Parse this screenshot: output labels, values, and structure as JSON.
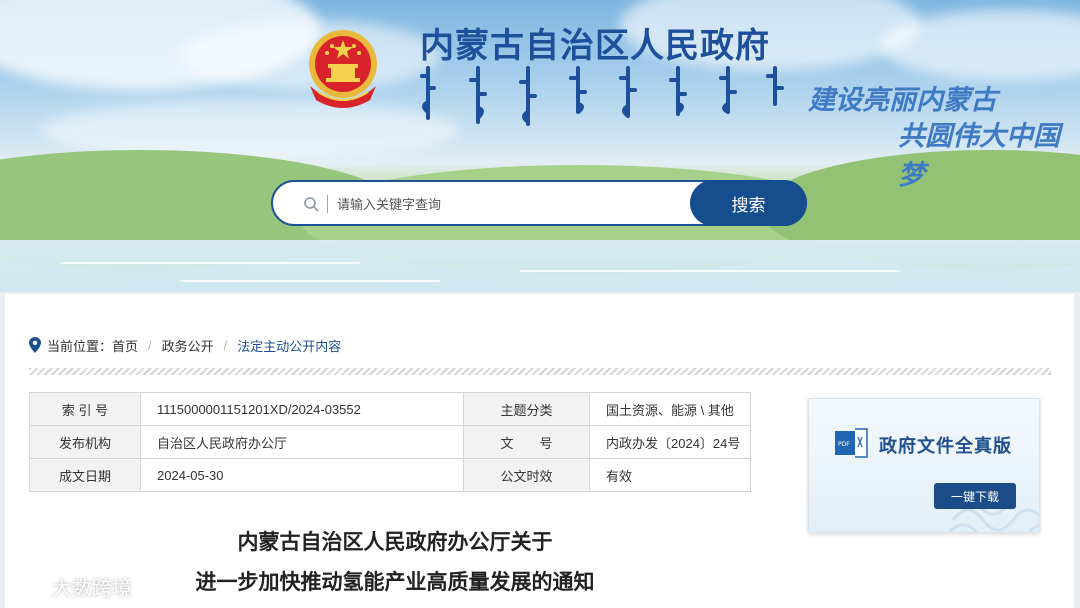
{
  "header": {
    "site_title": "内蒙古自治区人民政府",
    "slogan_line1": "建设亮丽内蒙古",
    "slogan_line2": "共圆伟大中国梦",
    "emblem_icon": "national-emblem-icon"
  },
  "search": {
    "placeholder": "请输入关键字查询",
    "value": "",
    "button_label": "搜索"
  },
  "breadcrumb": {
    "prefix": "当前位置：",
    "items": [
      "首页",
      "政务公开",
      "法定主动公开内容"
    ]
  },
  "info_table": {
    "rows": [
      {
        "label1": "索 引 号",
        "value1": "11150000011512​01XD/2024-03552",
        "label2": "主题分类",
        "value2": "国土资源、能源 \\ 其他"
      },
      {
        "label1": "发布机构",
        "value1": "自治区人民政府办公厅",
        "label2": "文　　号",
        "value2": "内政办发〔2024〕24号"
      },
      {
        "label1": "成文日期",
        "value1": "2024-05-30",
        "label2": "公文时效",
        "value2": "有效"
      }
    ]
  },
  "fulltext": {
    "title": "政府文件全真版",
    "download_label": "一键下载",
    "icon": "pdf-icon"
  },
  "document": {
    "title_line1": "内蒙古自治区人民政府办公厅关于",
    "title_line2": "进一步加快推动氢能产业高质量发展的通知"
  },
  "watermark": {
    "text": "大数跨境"
  },
  "colors": {
    "brand_blue": "#164d8e",
    "title_blue": "#1d4f9a",
    "slogan_blue": "#3f7ac4",
    "table_label_bg": "#f2f2f2"
  }
}
